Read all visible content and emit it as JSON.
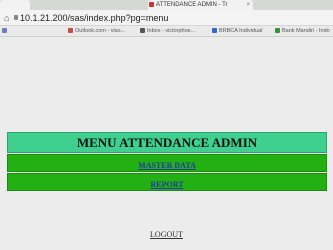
{
  "browser": {
    "tabs": [
      {
        "label": ""
      },
      {
        "label": "ATTENDANCE ADMIN - Tr"
      }
    ],
    "url": "10.1.21.200/sas/index.php?pg=menu",
    "bookmarks": [
      {
        "label": "",
        "color": "#6a7fbf"
      },
      {
        "label": "Outlook.com - viso...",
        "color": "#c84a4a"
      },
      {
        "label": "Inbox - victorphoe...",
        "color": "#555555"
      },
      {
        "label": "BRBCA Individual",
        "color": "#2f6bbf"
      },
      {
        "label": "Bank Mandiri - Indo",
        "color": "#3b8f3b"
      }
    ]
  },
  "menu": {
    "title": "MENU ATTENDANCE ADMIN",
    "items": [
      {
        "label": "MASTER DATA"
      },
      {
        "label": "REPORT"
      }
    ],
    "header_color": "#3fcf8f",
    "row_color": "#22b012",
    "link_color": "#2438a8"
  },
  "logout_label": "LOGOUT"
}
